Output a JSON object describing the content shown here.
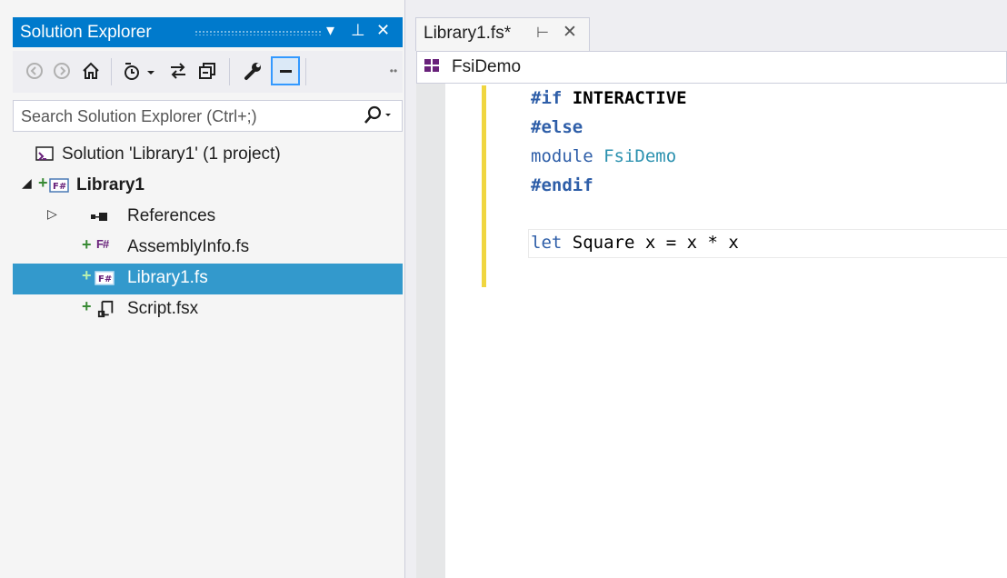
{
  "solution_explorer": {
    "title": "Solution Explorer",
    "controls": {
      "dropdown": "▾",
      "pin": "⊥",
      "close": "✕"
    },
    "search_placeholder": "Search Solution Explorer (Ctrl+;)",
    "tree": {
      "solution": "Solution 'Library1' (1 project)",
      "project": "Library1",
      "items": [
        {
          "label": "References",
          "kind": "references-icon"
        },
        {
          "label": "AssemblyInfo.fs",
          "kind": "fsharp-file-icon"
        },
        {
          "label": "Library1.fs",
          "kind": "fsharp-file-icon",
          "selected": true
        },
        {
          "label": "Script.fsx",
          "kind": "fsharp-script-icon"
        }
      ]
    },
    "colors": {
      "accent": "#007acc",
      "selection": "#3399cc"
    }
  },
  "editor": {
    "tab_label": "Library1.fs*",
    "navbar_label": "FsiDemo",
    "code": {
      "line1_directive": "#if",
      "line1_symbol": "INTERACTIVE",
      "line2": "#else",
      "line3_kw": "module",
      "line3_name": "FsiDemo",
      "line4": "#endif",
      "line6_kw": "let",
      "line6_rest": "Square x = x * x"
    }
  }
}
